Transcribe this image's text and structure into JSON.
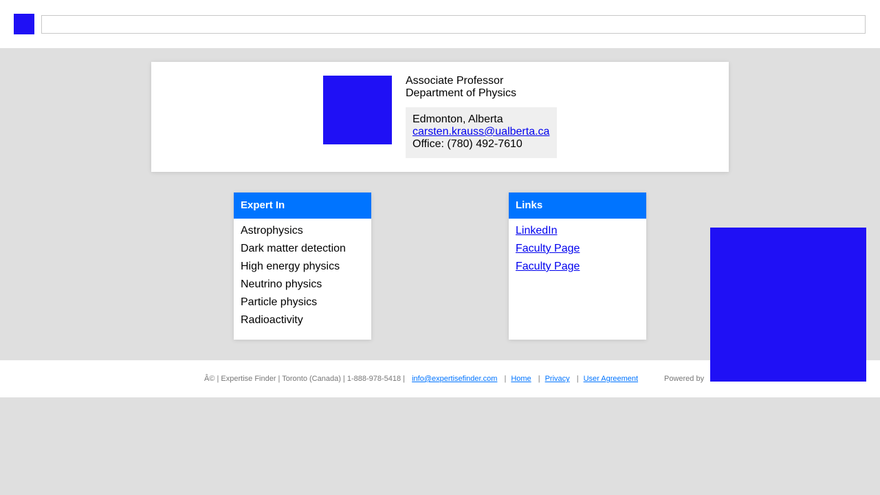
{
  "header": {
    "search": {
      "value": "",
      "placeholder": ""
    }
  },
  "profile": {
    "position": "Associate Professor",
    "department": "Department of Physics",
    "location": "Edmonton, Alberta",
    "email": "carsten.krauss@ualberta.ca",
    "office": "Office: (780) 492-7610"
  },
  "expert_in": {
    "heading": "Expert In",
    "items": [
      "Astrophysics",
      "Dark matter detection",
      "High energy physics",
      "Neutrino physics",
      "Particle physics",
      "Radioactivity"
    ]
  },
  "links": {
    "heading": "Links",
    "items": [
      "LinkedIn",
      "Faculty Page",
      "Faculty Page"
    ]
  },
  "footer": {
    "copyright": "Â© | Expertise Finder | Toronto (Canada) | 1-888-978-5418 |",
    "email": "info@expertisefinder.com",
    "separator": "|",
    "home": "Home",
    "privacy": "Privacy",
    "user_agreement": "User Agreement",
    "powered_by": "Powered by"
  },
  "colors": {
    "placeholder_block": "#1f10f5",
    "accent": "#0074ff",
    "link": "#0000ee",
    "background": "#dfdfdf"
  }
}
